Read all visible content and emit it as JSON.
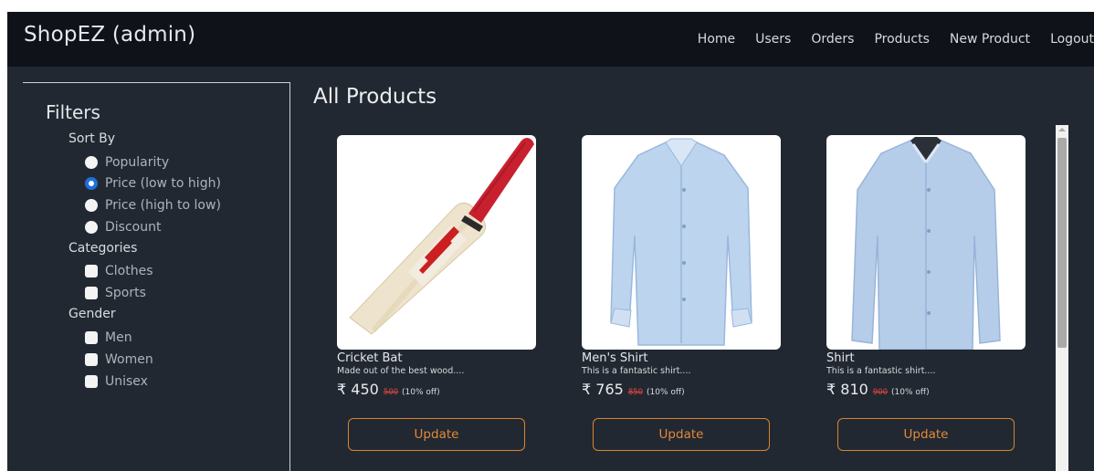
{
  "navbar": {
    "brand": "ShopEZ (admin)",
    "links": [
      "Home",
      "Users",
      "Orders",
      "Products",
      "New Product",
      "Logout"
    ]
  },
  "filters": {
    "title": "Filters",
    "sort_by": {
      "label": "Sort By",
      "options": [
        "Popularity",
        "Price (low to high)",
        "Price (high to low)",
        "Discount"
      ],
      "selected": "Price (low to high)"
    },
    "categories": {
      "label": "Categories",
      "options": [
        "Clothes",
        "Sports"
      ]
    },
    "gender": {
      "label": "Gender",
      "options": [
        "Men",
        "Women",
        "Unisex"
      ]
    }
  },
  "main": {
    "title": "All Products",
    "products": [
      {
        "name": "Cricket Bat",
        "description": "Made out of the best wood....",
        "price": "₹ 450",
        "old_price": "500",
        "discount": "(10% off)",
        "button": "Update",
        "image_icon": "cricket-bat-image"
      },
      {
        "name": "Men's Shirt",
        "description": "This is a fantastic shirt....",
        "price": "₹ 765",
        "old_price": "850",
        "discount": "(10% off)",
        "button": "Update",
        "image_icon": "shirt-image"
      },
      {
        "name": "Shirt",
        "description": "This is a fantastic shirt....",
        "price": "₹ 810",
        "old_price": "900",
        "discount": "(10% off)",
        "button": "Update",
        "image_icon": "shirt-image"
      }
    ]
  },
  "colors": {
    "navbar_bg": "#0f1219",
    "page_bg": "#222831",
    "accent_orange": "#d9832e",
    "strike_red": "#e0453f",
    "radio_selected": "#1e6fdb"
  }
}
